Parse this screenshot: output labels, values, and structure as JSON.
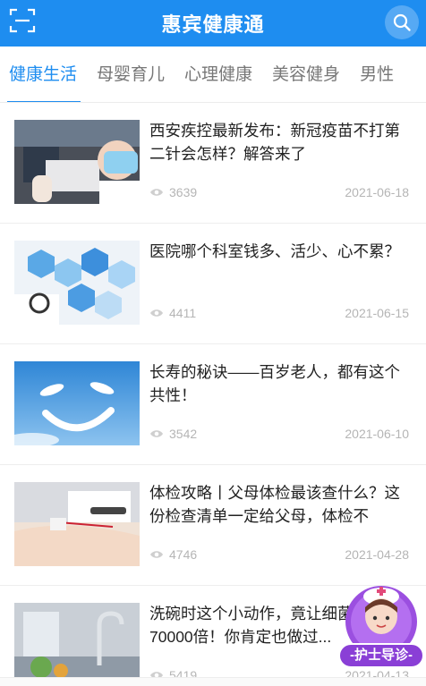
{
  "header": {
    "title": "惠宾健康通",
    "scan_icon": "scan-icon",
    "search_icon": "search-icon"
  },
  "tabs": [
    {
      "label": "健康生活",
      "active": true
    },
    {
      "label": "母婴育儿",
      "active": false
    },
    {
      "label": "心理健康",
      "active": false
    },
    {
      "label": "美容健身",
      "active": false
    },
    {
      "label": "男性",
      "active": false
    }
  ],
  "articles": [
    {
      "title": "西安疾控最新发布：新冠疫苗不打第二针会怎样？解答来了",
      "views": "3639",
      "date": "2021-06-18"
    },
    {
      "title": "医院哪个科室钱多、活少、心不累？",
      "views": "4411",
      "date": "2021-06-15"
    },
    {
      "title": "长寿的秘诀——百岁老人，都有这个共性！",
      "views": "3542",
      "date": "2021-06-10"
    },
    {
      "title": "体检攻略丨父母体检最该查什么？这份检查清单一定给父母，体检不",
      "views": "4746",
      "date": "2021-04-28"
    },
    {
      "title": "洗碗时这个小动作，竟让细菌增加70000倍！你肯定也做过...",
      "views": "5419",
      "date": "2021-04-13"
    }
  ],
  "float_badge": {
    "label": "-护士导诊-"
  },
  "colors": {
    "accent": "#1e8df0",
    "badge": "#8a3fd6"
  }
}
